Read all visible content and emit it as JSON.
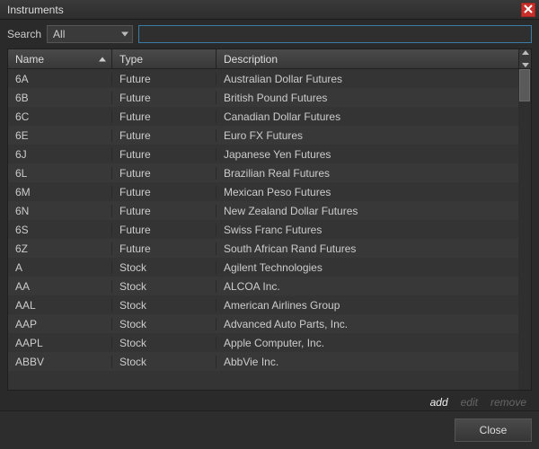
{
  "window": {
    "title": "Instruments"
  },
  "search": {
    "label": "Search",
    "filter_selected": "All",
    "input_value": ""
  },
  "table": {
    "columns": {
      "name": "Name",
      "type": "Type",
      "description": "Description"
    },
    "sort": {
      "column": "name",
      "direction": "asc"
    },
    "rows": [
      {
        "name": "6A",
        "type": "Future",
        "description": "Australian Dollar Futures"
      },
      {
        "name": "6B",
        "type": "Future",
        "description": "British Pound Futures"
      },
      {
        "name": "6C",
        "type": "Future",
        "description": "Canadian Dollar Futures"
      },
      {
        "name": "6E",
        "type": "Future",
        "description": "Euro FX Futures"
      },
      {
        "name": "6J",
        "type": "Future",
        "description": "Japanese Yen Futures"
      },
      {
        "name": "6L",
        "type": "Future",
        "description": "Brazilian Real Futures"
      },
      {
        "name": "6M",
        "type": "Future",
        "description": "Mexican Peso Futures"
      },
      {
        "name": "6N",
        "type": "Future",
        "description": "New Zealand Dollar Futures"
      },
      {
        "name": "6S",
        "type": "Future",
        "description": "Swiss Franc Futures"
      },
      {
        "name": "6Z",
        "type": "Future",
        "description": "South African Rand Futures"
      },
      {
        "name": "A",
        "type": "Stock",
        "description": "Agilent Technologies"
      },
      {
        "name": "AA",
        "type": "Stock",
        "description": "ALCOA Inc."
      },
      {
        "name": "AAL",
        "type": "Stock",
        "description": "American Airlines Group"
      },
      {
        "name": "AAP",
        "type": "Stock",
        "description": "Advanced Auto Parts, Inc."
      },
      {
        "name": "AAPL",
        "type": "Stock",
        "description": "Apple Computer, Inc."
      },
      {
        "name": "ABBV",
        "type": "Stock",
        "description": "AbbVie Inc."
      }
    ]
  },
  "actions": {
    "add": "add",
    "edit": "edit",
    "remove": "remove"
  },
  "footer": {
    "close": "Close"
  }
}
